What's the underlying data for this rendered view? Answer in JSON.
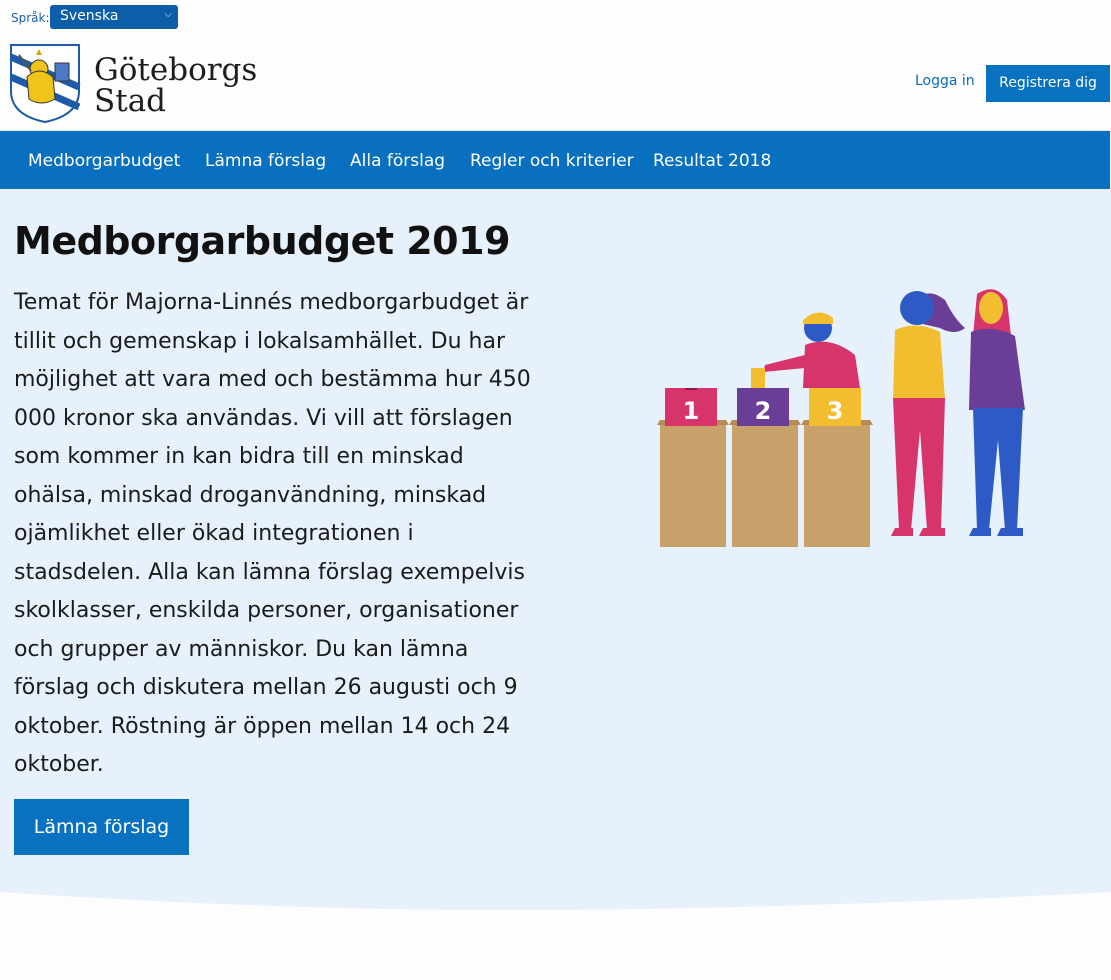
{
  "language": {
    "label": "Språk:",
    "selected": "Svenska"
  },
  "logo": {
    "line1": "Göteborgs",
    "line2": "Stad"
  },
  "auth": {
    "login": "Logga in",
    "register": "Registrera dig"
  },
  "nav": [
    {
      "label": "Medborgarbudget"
    },
    {
      "label": "Lämna förslag"
    },
    {
      "label": "Alla förslag"
    },
    {
      "label": "Regler och kriterier"
    },
    {
      "label": "Resultat 2018"
    }
  ],
  "hero": {
    "title": "Medborgarbudget 2019",
    "description": "Temat för Majorna-Linnés medborgarbudget är tillit och gemenskap i lokalsamhället. Du har möjlighet att vara med och bestämma hur 450 000 kronor ska användas. Vi vill att förslagen som kommer in kan bidra till en minskad ohälsa, minskad droganvändning, minskad ojämlikhet eller ökad integrationen i stadsdelen. Alla kan lämna förslag exempelvis skolklasser, enskilda personer, organisationer och grupper av människor. Du kan lämna förslag och diskutera mellan 26 augusti och 9 oktober. Röstning är öppen mellan 14 och 24 oktober.",
    "cta": "Lämna förslag",
    "ballot_labels": [
      "1",
      "2",
      "3"
    ]
  },
  "colors": {
    "brand_blue": "#0870be",
    "hero_bg": "#e6f1fb"
  }
}
